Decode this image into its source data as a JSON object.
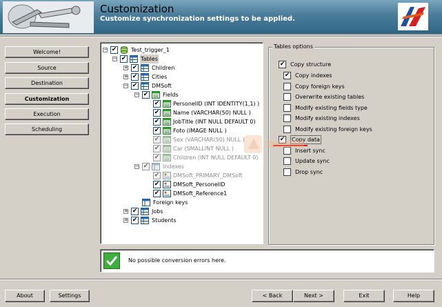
{
  "header": {
    "title": "Customization",
    "subtitle": "Customize synchronization settings to be applied."
  },
  "nav": [
    {
      "label": "Welcome!",
      "active": false
    },
    {
      "label": "Source",
      "active": false
    },
    {
      "label": "Destination",
      "active": false
    },
    {
      "label": "Customization",
      "active": true
    },
    {
      "label": "Execution",
      "active": false
    },
    {
      "label": "Scheduling",
      "active": false
    }
  ],
  "tree": {
    "root": "Test_trigger_1",
    "tables": "Tables",
    "children": "Children",
    "cities": "Cities",
    "dmsoft": "DMSoft",
    "fields": "Fields",
    "field_personelid": "PersonelID (INT IDENTITY(1,1) )",
    "field_name": "Name (VARCHAR(50) NULL )",
    "field_jobtitle": "JobTitle (INT NULL  DEFAULT 0)",
    "field_foto": "Foto (IMAGE NULL )",
    "field_sex": "Sex (VARCHAR(50) NULL )",
    "field_car": "Car (SMALLINT NULL )",
    "field_children": "Children (INT NULL  DEFAULT 0)",
    "indexes": "Indexes",
    "idx_primary": "DMSoft_PRIMARY_DMSoft",
    "idx_personelid": "DMSoft_PersonelID",
    "idx_reference": "DMSoft_Reference1",
    "foreign_keys": "Foreign keys",
    "jobs": "Jobs",
    "students": "Students"
  },
  "options": {
    "legend": "Tables options",
    "items": [
      {
        "label": "Copy structure",
        "checked": true
      },
      {
        "label": "Copy indexes",
        "checked": true
      },
      {
        "label": "Copy foreign keys",
        "checked": false
      },
      {
        "label": "Overwrite existing tables",
        "checked": false
      },
      {
        "label": "Modify existing fields type",
        "checked": false
      },
      {
        "label": "Modify existing indexes",
        "checked": false
      },
      {
        "label": "Modify existing foreign keys",
        "checked": false
      },
      {
        "label": "Copy data",
        "checked": true
      },
      {
        "label": "Insert sync",
        "checked": false
      },
      {
        "label": "Update sync",
        "checked": false
      },
      {
        "label": "Drop sync",
        "checked": false
      }
    ]
  },
  "status": {
    "text": "No possible conversion errors here."
  },
  "buttons": {
    "about": "About",
    "settings": "Settings",
    "back": "< Back",
    "next": "Next >",
    "exit": "Exit",
    "help": "Help"
  },
  "colors": {
    "header_bg": "#4d7f9c",
    "window_bg": "#d4d0c8",
    "check_green": "#2e9b2e",
    "annotation_red": "#e01010"
  }
}
